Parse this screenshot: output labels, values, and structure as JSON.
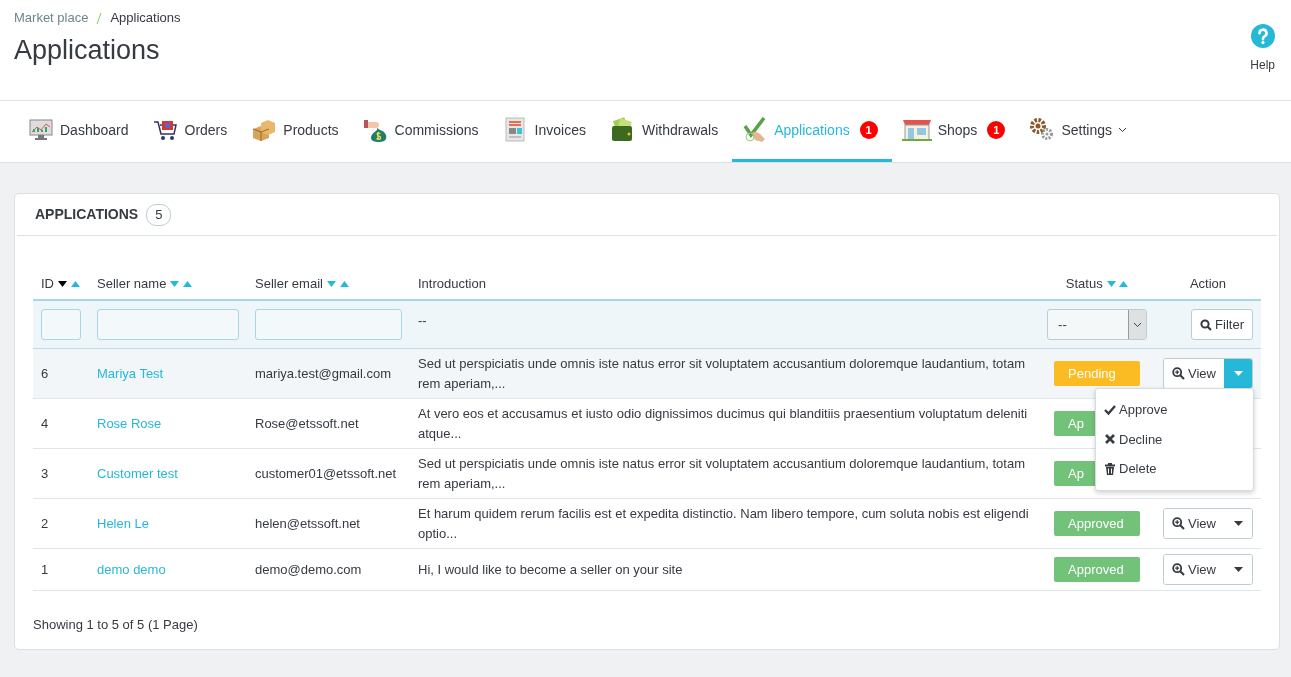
{
  "breadcrumb": [
    {
      "label": "Market place"
    },
    {
      "label": "Applications"
    }
  ],
  "page_title": "Applications",
  "help": {
    "label": "Help"
  },
  "tabs": [
    {
      "label": "Dashboard",
      "selected": false
    },
    {
      "label": "Orders",
      "selected": false
    },
    {
      "label": "Products",
      "selected": false
    },
    {
      "label": "Commissions",
      "selected": false
    },
    {
      "label": "Invoices",
      "selected": false
    },
    {
      "label": "Withdrawals",
      "selected": false
    },
    {
      "label": "Applications",
      "selected": true,
      "badge": "1"
    },
    {
      "label": "Shops",
      "selected": false,
      "badge": "1"
    },
    {
      "label": "Settings",
      "selected": false,
      "dropdown": true
    }
  ],
  "panel": {
    "title": "APPLICATIONS",
    "count": "5"
  },
  "table": {
    "columns": [
      {
        "label": "ID",
        "sorted": true,
        "kind": "input"
      },
      {
        "label": "Seller name",
        "sorted": false,
        "kind": "input"
      },
      {
        "label": "Seller email",
        "sorted": false,
        "kind": "input"
      },
      {
        "label": "Introduction",
        "kind": "text",
        "filter_text": "--"
      },
      {
        "label": "Status",
        "sorted": false,
        "kind": "select",
        "filter_text": "--"
      },
      {
        "label": "Action",
        "kind": "button",
        "filter_text": "Filter"
      }
    ],
    "rows": [
      {
        "id": "6",
        "name": "Mariya Test",
        "email": "mariya.test@gmail.com",
        "introduction": "Sed ut perspiciatis unde omnis iste natus error sit voluptatem accusantium doloremque laudantium, totam rem aperiam,...",
        "status": "Pending",
        "color": "#fbbb22",
        "selected": true,
        "action": "View",
        "menu_open": true
      },
      {
        "id": "4",
        "name": "Rose Rose",
        "email": "Rose@etssoft.net",
        "introduction": "At vero eos et accusamus et iusto odio dignissimos ducimus qui blanditiis praesentium voluptatum deleniti atque...",
        "status": "Ap",
        "color": "#72c279",
        "selected": false
      },
      {
        "id": "3",
        "name": "Customer test",
        "email": "customer01@etssoft.net",
        "introduction": "Sed ut perspiciatis unde omnis iste natus error sit voluptatem accusantium doloremque laudantium, totam rem aperiam,...",
        "status": "Ap",
        "color": "#72c279",
        "selected": false
      },
      {
        "id": "2",
        "name": "Helen Le",
        "email": "helen@etssoft.net",
        "introduction": "Et harum quidem rerum facilis est et expedita distinctio. Nam libero tempore, cum soluta nobis est eligendi optio...",
        "status": "Approved",
        "color": "#72c279",
        "selected": false,
        "action": "View",
        "menu_open": false
      },
      {
        "id": "1",
        "name": "demo demo",
        "email": "demo@demo.com",
        "introduction": "Hi, I would like to become a seller on your site",
        "status": "Approved",
        "color": "#72c279",
        "selected": false,
        "action": "View",
        "menu_open": false
      }
    ],
    "menu": [
      {
        "label": "Approve"
      },
      {
        "label": "Decline"
      },
      {
        "label": "Delete"
      }
    ]
  },
  "footer": "Showing 1 to 5 of 5 (1 Page)"
}
